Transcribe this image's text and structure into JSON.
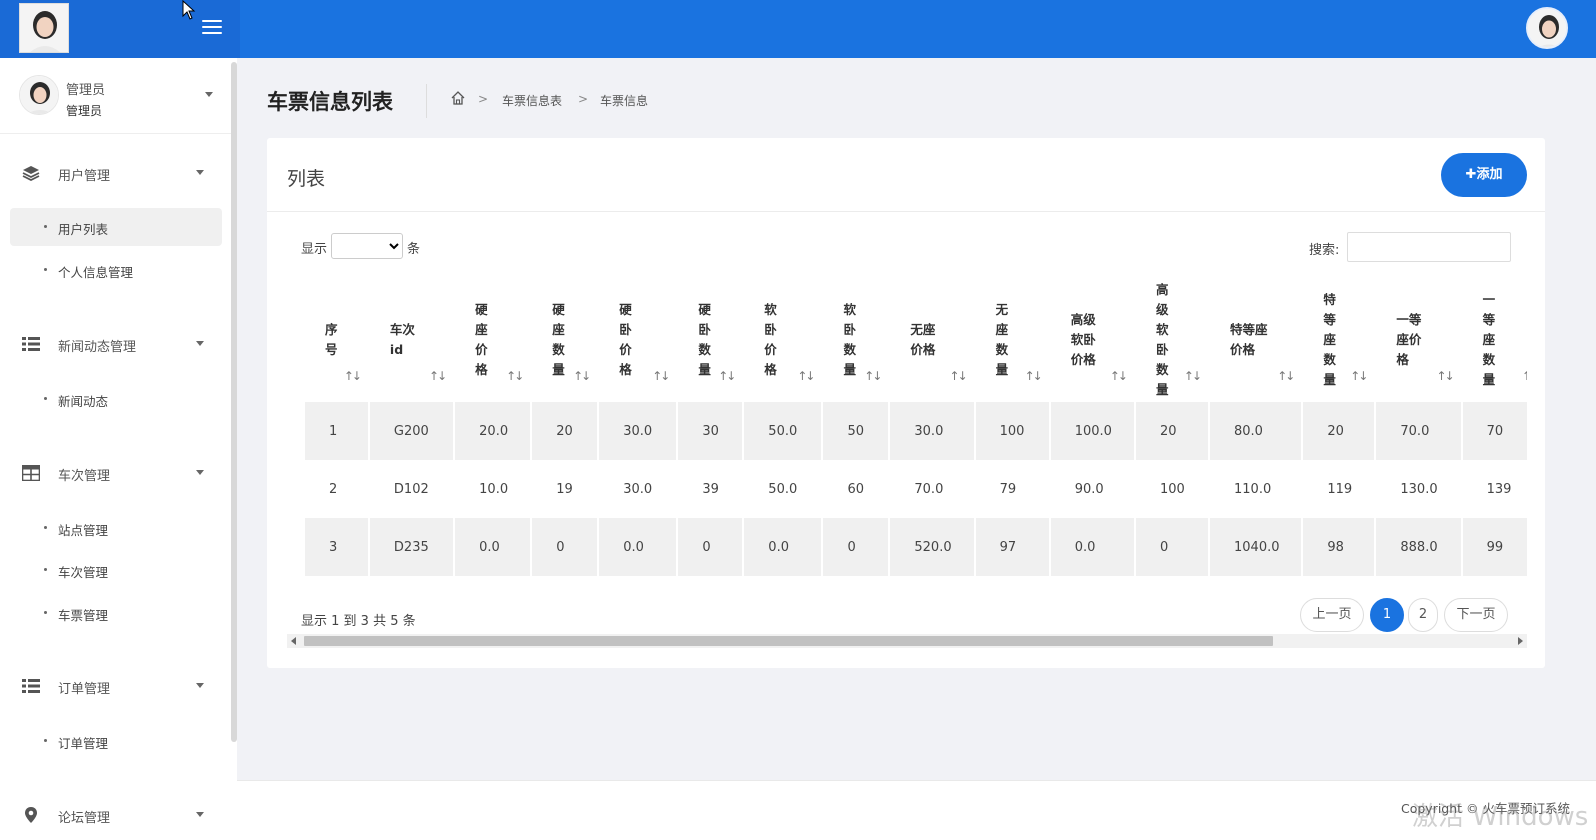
{
  "admin": {
    "name": "管理员",
    "role": "管理员"
  },
  "page": {
    "title": "车票信息列表",
    "breadcrumb": [
      "车票信息表",
      "车票信息"
    ]
  },
  "menu": {
    "groups": [
      {
        "label": "用户管理",
        "icon": "layers-icon",
        "items": [
          {
            "label": "用户列表",
            "active": true
          },
          {
            "label": "个人信息管理"
          }
        ]
      },
      {
        "label": "新闻动态管理",
        "icon": "list-icon",
        "items": [
          {
            "label": "新闻动态"
          }
        ]
      },
      {
        "label": "车次管理",
        "icon": "grid-icon",
        "items": [
          {
            "label": "站点管理"
          },
          {
            "label": "车次管理"
          },
          {
            "label": "车票管理"
          }
        ]
      },
      {
        "label": "订单管理",
        "icon": "list-icon",
        "items": [
          {
            "label": "订单管理"
          }
        ]
      },
      {
        "label": "论坛管理",
        "icon": "map-pin-icon",
        "items": []
      }
    ]
  },
  "card": {
    "title": "列表",
    "add_label": "✚添加",
    "show_label": "显示",
    "show_unit": "条",
    "search_label": "搜索:",
    "info": "显示 1 到 3 共 5 条",
    "pager": {
      "prev": "上一页",
      "pages": [
        "1",
        "2"
      ],
      "current": "1",
      "next": "下一页"
    }
  },
  "table": {
    "columns": [
      "序\n号",
      "车次\nid",
      "硬\n座\n价\n格",
      "硬\n座\n数\n量",
      "硬\n卧\n价\n格",
      "硬\n卧\n数\n量",
      "软\n卧\n价\n格",
      "软\n卧\n数\n量",
      "无座\n价格",
      "无\n座\n数\n量",
      "高级\n软卧\n价格",
      "高\n级\n软\n卧\n数\n量",
      "特等座\n价格",
      "特\n等\n座\n数\n量",
      "一等\n座价\n格",
      "一\n等\n座\n数\n量"
    ],
    "rows": [
      [
        "1",
        "G200",
        "20.0",
        "20",
        "30.0",
        "30",
        "50.0",
        "50",
        "30.0",
        "100",
        "100.0",
        "20",
        "80.0",
        "20",
        "70.0",
        "70"
      ],
      [
        "2",
        "D102",
        "10.0",
        "19",
        "30.0",
        "39",
        "50.0",
        "60",
        "70.0",
        "79",
        "90.0",
        "100",
        "110.0",
        "119",
        "130.0",
        "139"
      ],
      [
        "3",
        "D235",
        "0.0",
        "0",
        "0.0",
        "0",
        "0.0",
        "0",
        "520.0",
        "97",
        "0.0",
        "0",
        "1040.0",
        "98",
        "888.0",
        "99"
      ]
    ]
  },
  "footer": {
    "copyright": "Copyright © 火车票预订系统"
  },
  "watermark": "激活 Windows",
  "colors": {
    "primary": "#1a73e0",
    "sidebar_bg": "#ffffff",
    "page_bg": "#f1f2f6"
  }
}
